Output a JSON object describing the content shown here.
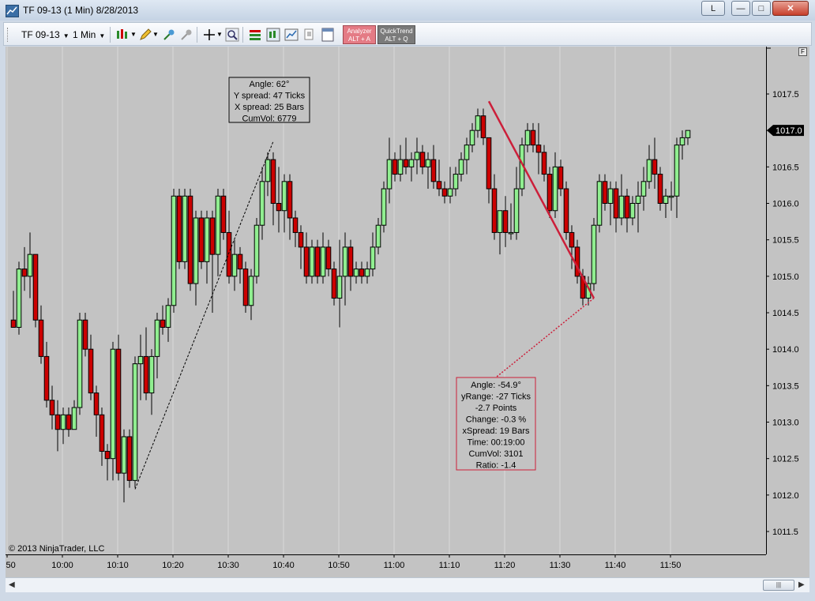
{
  "window": {
    "title": "TF 09-13 (1 Min)  8/28/2013",
    "btn_l": "L",
    "btn_min": "—",
    "btn_max": "□",
    "btn_close": "✕"
  },
  "toolbar": {
    "instrument": "TF 09-13",
    "interval": "1 Min",
    "analyzer_line1": "Analyzer",
    "analyzer_line2": "ALT + A",
    "quicktrend_line1": "QuickTrend",
    "quicktrend_line2": "ALT + Q"
  },
  "chart": {
    "copyright": "© 2013 NinjaTrader, LLC",
    "f_button": "F",
    "current_price_label": "1017.0",
    "annotation_up": [
      "Angle: 62°",
      "Y spread: 47 Ticks",
      "X spread: 25 Bars",
      "CumVol: 6779"
    ],
    "annotation_down": [
      "Angle: -54.9°",
      "yRange: -27 Ticks",
      "-2.7 Points",
      "Change: -0.3 %",
      "xSpread: 19 Bars",
      "Time: 00:19:00",
      "CumVol: 3101",
      "Ratio: -1.4"
    ]
  },
  "chart_data": {
    "type": "candlestick",
    "instrument": "TF 09-13",
    "interval": "1 Min",
    "x_ticks": [
      "9:50",
      "10:00",
      "10:10",
      "10:20",
      "10:30",
      "10:40",
      "10:50",
      "11:00",
      "11:10",
      "11:20",
      "11:30",
      "11:40",
      "11:50"
    ],
    "y_ticks": [
      "1017.5",
      "1017.0",
      "1016.5",
      "1016.0",
      "1015.5",
      "1015.0",
      "1014.5",
      "1014.0",
      "1013.5",
      "1013.0",
      "1012.5",
      "1012.0",
      "1011.5"
    ],
    "ylim": [
      1011.3,
      1018.0
    ],
    "last_price": 1017.0,
    "candle_colors": {
      "up": "#90ee90",
      "down": "#cc0000",
      "outline": "#000000"
    },
    "candles": [
      {
        "o": 1014.4,
        "h": 1014.8,
        "l": 1014.3,
        "c": 1014.3
      },
      {
        "o": 1014.3,
        "h": 1015.2,
        "l": 1014.2,
        "c": 1015.1
      },
      {
        "o": 1015.1,
        "h": 1015.4,
        "l": 1014.8,
        "c": 1015.0
      },
      {
        "o": 1015.0,
        "h": 1015.6,
        "l": 1014.7,
        "c": 1015.3
      },
      {
        "o": 1015.3,
        "h": 1015.3,
        "l": 1014.3,
        "c": 1014.4
      },
      {
        "o": 1014.4,
        "h": 1014.6,
        "l": 1013.8,
        "c": 1013.9
      },
      {
        "o": 1013.9,
        "h": 1014.1,
        "l": 1013.2,
        "c": 1013.3
      },
      {
        "o": 1013.3,
        "h": 1013.5,
        "l": 1012.9,
        "c": 1013.1
      },
      {
        "o": 1013.1,
        "h": 1013.3,
        "l": 1012.6,
        "c": 1012.9
      },
      {
        "o": 1012.9,
        "h": 1013.2,
        "l": 1012.7,
        "c": 1013.1
      },
      {
        "o": 1013.1,
        "h": 1013.2,
        "l": 1012.8,
        "c": 1012.9
      },
      {
        "o": 1012.9,
        "h": 1013.3,
        "l": 1012.9,
        "c": 1013.2
      },
      {
        "o": 1013.2,
        "h": 1014.5,
        "l": 1013.1,
        "c": 1014.4
      },
      {
        "o": 1014.4,
        "h": 1014.5,
        "l": 1013.9,
        "c": 1014.0
      },
      {
        "o": 1014.0,
        "h": 1014.2,
        "l": 1013.3,
        "c": 1013.4
      },
      {
        "o": 1013.4,
        "h": 1013.5,
        "l": 1012.8,
        "c": 1013.1
      },
      {
        "o": 1013.1,
        "h": 1013.2,
        "l": 1012.4,
        "c": 1012.6
      },
      {
        "o": 1012.6,
        "h": 1012.7,
        "l": 1012.2,
        "c": 1012.5
      },
      {
        "o": 1012.5,
        "h": 1014.1,
        "l": 1012.2,
        "c": 1014.0
      },
      {
        "o": 1014.0,
        "h": 1014.2,
        "l": 1012.2,
        "c": 1012.3
      },
      {
        "o": 1012.3,
        "h": 1012.9,
        "l": 1011.9,
        "c": 1012.8
      },
      {
        "o": 1012.8,
        "h": 1012.9,
        "l": 1012.1,
        "c": 1012.2
      },
      {
        "o": 1012.2,
        "h": 1013.9,
        "l": 1012.1,
        "c": 1013.8
      },
      {
        "o": 1013.8,
        "h": 1014.2,
        "l": 1013.3,
        "c": 1013.9
      },
      {
        "o": 1013.9,
        "h": 1014.3,
        "l": 1013.3,
        "c": 1013.4
      },
      {
        "o": 1013.4,
        "h": 1014.0,
        "l": 1013.1,
        "c": 1013.9
      },
      {
        "o": 1013.9,
        "h": 1014.5,
        "l": 1013.6,
        "c": 1014.4
      },
      {
        "o": 1014.4,
        "h": 1014.6,
        "l": 1014.2,
        "c": 1014.3
      },
      {
        "o": 1014.3,
        "h": 1014.7,
        "l": 1014.1,
        "c": 1014.6
      },
      {
        "o": 1014.6,
        "h": 1016.2,
        "l": 1014.5,
        "c": 1016.1
      },
      {
        "o": 1016.1,
        "h": 1016.2,
        "l": 1015.1,
        "c": 1015.2
      },
      {
        "o": 1015.2,
        "h": 1016.2,
        "l": 1015.1,
        "c": 1016.1
      },
      {
        "o": 1016.1,
        "h": 1016.2,
        "l": 1014.8,
        "c": 1014.9
      },
      {
        "o": 1014.9,
        "h": 1015.9,
        "l": 1014.6,
        "c": 1015.8
      },
      {
        "o": 1015.8,
        "h": 1015.9,
        "l": 1015.1,
        "c": 1015.2
      },
      {
        "o": 1015.2,
        "h": 1015.9,
        "l": 1014.9,
        "c": 1015.8
      },
      {
        "o": 1015.8,
        "h": 1015.9,
        "l": 1014.5,
        "c": 1015.3
      },
      {
        "o": 1015.3,
        "h": 1016.2,
        "l": 1015.0,
        "c": 1016.1
      },
      {
        "o": 1016.1,
        "h": 1016.2,
        "l": 1015.5,
        "c": 1015.6
      },
      {
        "o": 1015.6,
        "h": 1015.9,
        "l": 1014.9,
        "c": 1015.0
      },
      {
        "o": 1015.0,
        "h": 1015.5,
        "l": 1014.8,
        "c": 1015.3
      },
      {
        "o": 1015.3,
        "h": 1015.4,
        "l": 1014.9,
        "c": 1015.1
      },
      {
        "o": 1015.1,
        "h": 1015.2,
        "l": 1014.5,
        "c": 1014.6
      },
      {
        "o": 1014.6,
        "h": 1015.1,
        "l": 1014.4,
        "c": 1015.0
      },
      {
        "o": 1015.0,
        "h": 1015.8,
        "l": 1014.9,
        "c": 1015.7
      },
      {
        "o": 1015.7,
        "h": 1016.5,
        "l": 1015.5,
        "c": 1016.3
      },
      {
        "o": 1016.3,
        "h": 1016.7,
        "l": 1016.1,
        "c": 1016.6
      },
      {
        "o": 1016.6,
        "h": 1016.7,
        "l": 1015.7,
        "c": 1016.0
      },
      {
        "o": 1016.0,
        "h": 1016.5,
        "l": 1015.6,
        "c": 1015.9
      },
      {
        "o": 1015.9,
        "h": 1016.4,
        "l": 1015.6,
        "c": 1016.3
      },
      {
        "o": 1016.3,
        "h": 1016.4,
        "l": 1015.5,
        "c": 1015.8
      },
      {
        "o": 1015.8,
        "h": 1015.9,
        "l": 1015.4,
        "c": 1015.6
      },
      {
        "o": 1015.6,
        "h": 1015.7,
        "l": 1015.1,
        "c": 1015.4
      },
      {
        "o": 1015.4,
        "h": 1015.6,
        "l": 1014.9,
        "c": 1015.0
      },
      {
        "o": 1015.0,
        "h": 1015.5,
        "l": 1014.9,
        "c": 1015.4
      },
      {
        "o": 1015.4,
        "h": 1015.5,
        "l": 1014.9,
        "c": 1015.0
      },
      {
        "o": 1015.0,
        "h": 1015.6,
        "l": 1014.9,
        "c": 1015.4
      },
      {
        "o": 1015.4,
        "h": 1015.5,
        "l": 1015.0,
        "c": 1015.1
      },
      {
        "o": 1015.1,
        "h": 1015.2,
        "l": 1014.6,
        "c": 1014.7
      },
      {
        "o": 1014.7,
        "h": 1015.5,
        "l": 1014.3,
        "c": 1015.0
      },
      {
        "o": 1015.0,
        "h": 1015.6,
        "l": 1014.6,
        "c": 1015.4
      },
      {
        "o": 1015.4,
        "h": 1015.5,
        "l": 1014.8,
        "c": 1015.0
      },
      {
        "o": 1015.0,
        "h": 1015.2,
        "l": 1014.9,
        "c": 1015.1
      },
      {
        "o": 1015.1,
        "h": 1015.2,
        "l": 1014.9,
        "c": 1015.0
      },
      {
        "o": 1015.0,
        "h": 1015.2,
        "l": 1014.9,
        "c": 1015.1
      },
      {
        "o": 1015.1,
        "h": 1015.6,
        "l": 1015.0,
        "c": 1015.4
      },
      {
        "o": 1015.4,
        "h": 1015.8,
        "l": 1015.3,
        "c": 1015.7
      },
      {
        "o": 1015.7,
        "h": 1016.3,
        "l": 1015.6,
        "c": 1016.2
      },
      {
        "o": 1016.2,
        "h": 1016.9,
        "l": 1016.0,
        "c": 1016.6
      },
      {
        "o": 1016.6,
        "h": 1016.7,
        "l": 1016.3,
        "c": 1016.4
      },
      {
        "o": 1016.4,
        "h": 1016.8,
        "l": 1016.3,
        "c": 1016.6
      },
      {
        "o": 1016.6,
        "h": 1016.9,
        "l": 1016.4,
        "c": 1016.5
      },
      {
        "o": 1016.5,
        "h": 1016.7,
        "l": 1016.3,
        "c": 1016.6
      },
      {
        "o": 1016.6,
        "h": 1016.9,
        "l": 1016.4,
        "c": 1016.7
      },
      {
        "o": 1016.7,
        "h": 1016.8,
        "l": 1016.4,
        "c": 1016.5
      },
      {
        "o": 1016.5,
        "h": 1016.7,
        "l": 1016.2,
        "c": 1016.6
      },
      {
        "o": 1016.6,
        "h": 1016.8,
        "l": 1016.2,
        "c": 1016.3
      },
      {
        "o": 1016.3,
        "h": 1016.6,
        "l": 1016.1,
        "c": 1016.2
      },
      {
        "o": 1016.2,
        "h": 1016.3,
        "l": 1016.0,
        "c": 1016.1
      },
      {
        "o": 1016.1,
        "h": 1016.5,
        "l": 1016.0,
        "c": 1016.2
      },
      {
        "o": 1016.2,
        "h": 1016.5,
        "l": 1016.1,
        "c": 1016.4
      },
      {
        "o": 1016.4,
        "h": 1016.7,
        "l": 1016.3,
        "c": 1016.6
      },
      {
        "o": 1016.6,
        "h": 1016.9,
        "l": 1016.4,
        "c": 1016.8
      },
      {
        "o": 1016.8,
        "h": 1017.1,
        "l": 1016.7,
        "c": 1017.0
      },
      {
        "o": 1017.0,
        "h": 1017.3,
        "l": 1016.9,
        "c": 1017.2
      },
      {
        "o": 1017.2,
        "h": 1017.3,
        "l": 1016.8,
        "c": 1016.9
      },
      {
        "o": 1016.9,
        "h": 1016.9,
        "l": 1016.0,
        "c": 1016.2
      },
      {
        "o": 1016.2,
        "h": 1016.4,
        "l": 1015.5,
        "c": 1015.6
      },
      {
        "o": 1015.6,
        "h": 1015.9,
        "l": 1015.3,
        "c": 1015.9
      },
      {
        "o": 1015.9,
        "h": 1016.1,
        "l": 1015.4,
        "c": 1015.6
      },
      {
        "o": 1015.6,
        "h": 1016.0,
        "l": 1015.5,
        "c": 1015.6
      },
      {
        "o": 1015.6,
        "h": 1016.5,
        "l": 1015.5,
        "c": 1016.2
      },
      {
        "o": 1016.2,
        "h": 1016.9,
        "l": 1016.1,
        "c": 1016.8
      },
      {
        "o": 1016.8,
        "h": 1017.1,
        "l": 1016.7,
        "c": 1017.0
      },
      {
        "o": 1017.0,
        "h": 1017.1,
        "l": 1016.7,
        "c": 1016.8
      },
      {
        "o": 1016.8,
        "h": 1017.1,
        "l": 1016.4,
        "c": 1016.7
      },
      {
        "o": 1016.7,
        "h": 1016.8,
        "l": 1016.3,
        "c": 1016.4
      },
      {
        "o": 1016.4,
        "h": 1016.5,
        "l": 1015.8,
        "c": 1015.9
      },
      {
        "o": 1015.9,
        "h": 1016.7,
        "l": 1015.8,
        "c": 1016.5
      },
      {
        "o": 1016.5,
        "h": 1016.6,
        "l": 1016.1,
        "c": 1016.2
      },
      {
        "o": 1016.2,
        "h": 1016.3,
        "l": 1015.5,
        "c": 1015.6
      },
      {
        "o": 1015.6,
        "h": 1015.7,
        "l": 1015.1,
        "c": 1015.4
      },
      {
        "o": 1015.4,
        "h": 1015.5,
        "l": 1014.9,
        "c": 1015.0
      },
      {
        "o": 1015.0,
        "h": 1015.1,
        "l": 1014.6,
        "c": 1014.7
      },
      {
        "o": 1014.7,
        "h": 1015.0,
        "l": 1014.6,
        "c": 1014.9
      },
      {
        "o": 1014.9,
        "h": 1015.8,
        "l": 1014.8,
        "c": 1015.7
      },
      {
        "o": 1015.7,
        "h": 1016.4,
        "l": 1015.6,
        "c": 1016.3
      },
      {
        "o": 1016.3,
        "h": 1016.4,
        "l": 1015.9,
        "c": 1016.0
      },
      {
        "o": 1016.0,
        "h": 1016.3,
        "l": 1015.7,
        "c": 1016.2
      },
      {
        "o": 1016.2,
        "h": 1016.3,
        "l": 1015.6,
        "c": 1015.8
      },
      {
        "o": 1015.8,
        "h": 1016.4,
        "l": 1015.7,
        "c": 1016.1
      },
      {
        "o": 1016.1,
        "h": 1016.2,
        "l": 1015.6,
        "c": 1015.8
      },
      {
        "o": 1015.8,
        "h": 1016.1,
        "l": 1015.7,
        "c": 1016.0
      },
      {
        "o": 1016.0,
        "h": 1016.3,
        "l": 1015.6,
        "c": 1016.1
      },
      {
        "o": 1016.1,
        "h": 1016.5,
        "l": 1015.9,
        "c": 1016.3
      },
      {
        "o": 1016.3,
        "h": 1016.8,
        "l": 1016.2,
        "c": 1016.6
      },
      {
        "o": 1016.6,
        "h": 1016.9,
        "l": 1016.2,
        "c": 1016.4
      },
      {
        "o": 1016.4,
        "h": 1016.5,
        "l": 1015.9,
        "c": 1016.0
      },
      {
        "o": 1016.0,
        "h": 1016.2,
        "l": 1015.8,
        "c": 1016.1
      },
      {
        "o": 1016.1,
        "h": 1016.3,
        "l": 1015.9,
        "c": 1016.1
      },
      {
        "o": 1016.1,
        "h": 1016.9,
        "l": 1015.8,
        "c": 1016.8
      },
      {
        "o": 1016.8,
        "h": 1017.0,
        "l": 1016.6,
        "c": 1016.9
      },
      {
        "o": 1016.9,
        "h": 1017.0,
        "l": 1016.8,
        "c": 1017.0
      }
    ]
  }
}
